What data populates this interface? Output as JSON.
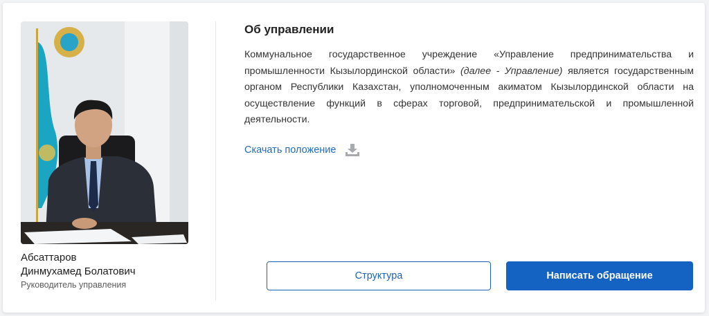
{
  "leader": {
    "name_line1": "Абсаттаров",
    "name_line2": "Динмухамед Болатович",
    "role": "Руководитель управления",
    "photo_icon": "portrait-photo"
  },
  "about": {
    "title": "Об управлении",
    "description_part1": "Коммунальное государственное учреждение «Управление предпринимательства и промышленности Кызылординской области»",
    "description_italic": "(далее - Управление)",
    "description_part2": "является государственным органом Республики Казахстан, уполномоченным акиматом Кызылординской области на осуществление функций в сферах торговой, предпринимательской и промышленной деятельности."
  },
  "download": {
    "label": "Скачать положение",
    "icon": "download-icon"
  },
  "buttons": {
    "structure_label": "Структура",
    "appeal_label": "Написать обращение"
  },
  "colors": {
    "accent": "#1463c2",
    "link": "#1f6bbf"
  }
}
